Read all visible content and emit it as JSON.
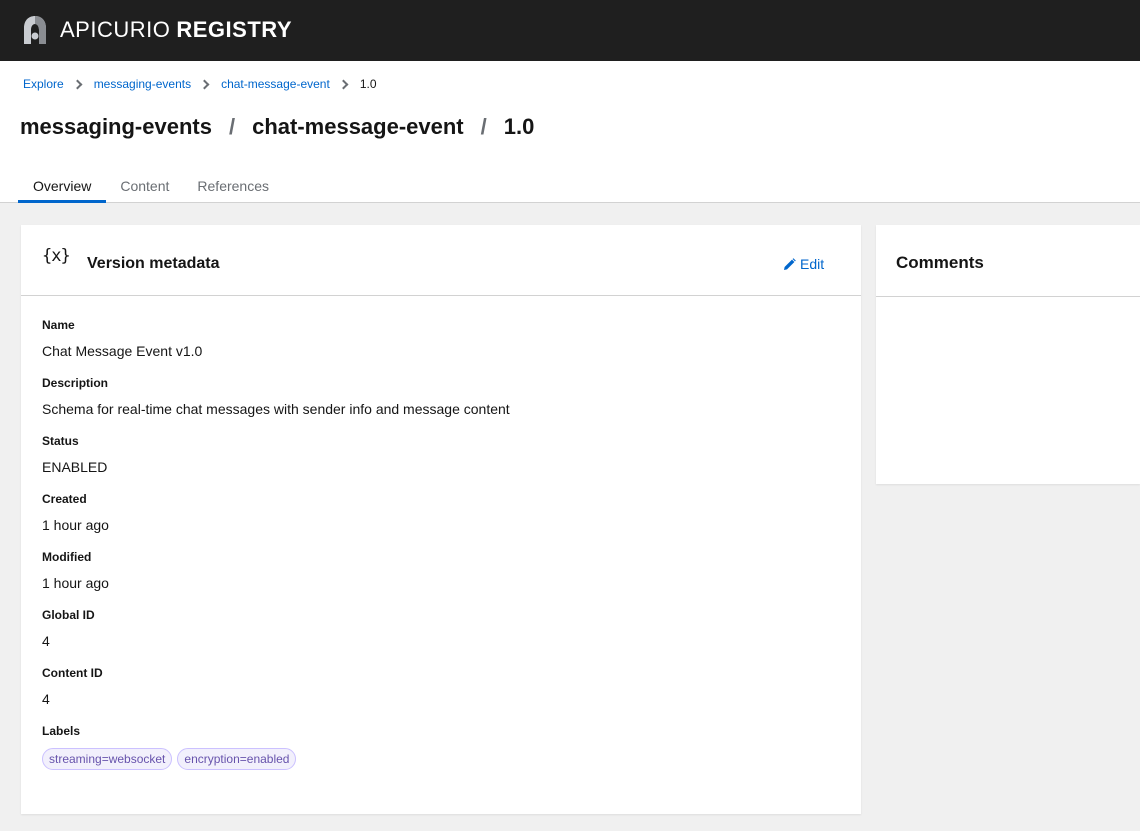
{
  "app": {
    "brand_light": "APICURIO",
    "brand_bold": "REGISTRY"
  },
  "breadcrumb": [
    "Explore",
    "messaging-events",
    "chat-message-event",
    "1.0"
  ],
  "title": {
    "group": "messaging-events",
    "artifact": "chat-message-event",
    "version": "1.0"
  },
  "tabs": [
    "Overview",
    "Content",
    "References"
  ],
  "active_tab": "Overview",
  "metadata_card": {
    "title": "Version metadata",
    "icon": "schema-icon",
    "icon_text": "{x}",
    "edit_label": "Edit",
    "fields": [
      {
        "label": "Name",
        "value": "Chat Message Event v1.0"
      },
      {
        "label": "Description",
        "value": "Schema for real-time chat messages with sender info and message content"
      },
      {
        "label": "Status",
        "value": "ENABLED"
      },
      {
        "label": "Created",
        "value": "1 hour ago"
      },
      {
        "label": "Modified",
        "value": "1 hour ago"
      },
      {
        "label": "Global ID",
        "value": "4"
      },
      {
        "label": "Content ID",
        "value": "4"
      }
    ],
    "labels_title": "Labels",
    "labels": [
      "streaming=websocket",
      "encryption=enabled"
    ]
  },
  "comments_card": {
    "title": "Comments"
  },
  "colors": {
    "masthead": "#1f1f1f",
    "link": "#0066cc",
    "chip_text": "#6753ac",
    "chip_bg": "#f2f0fc"
  }
}
